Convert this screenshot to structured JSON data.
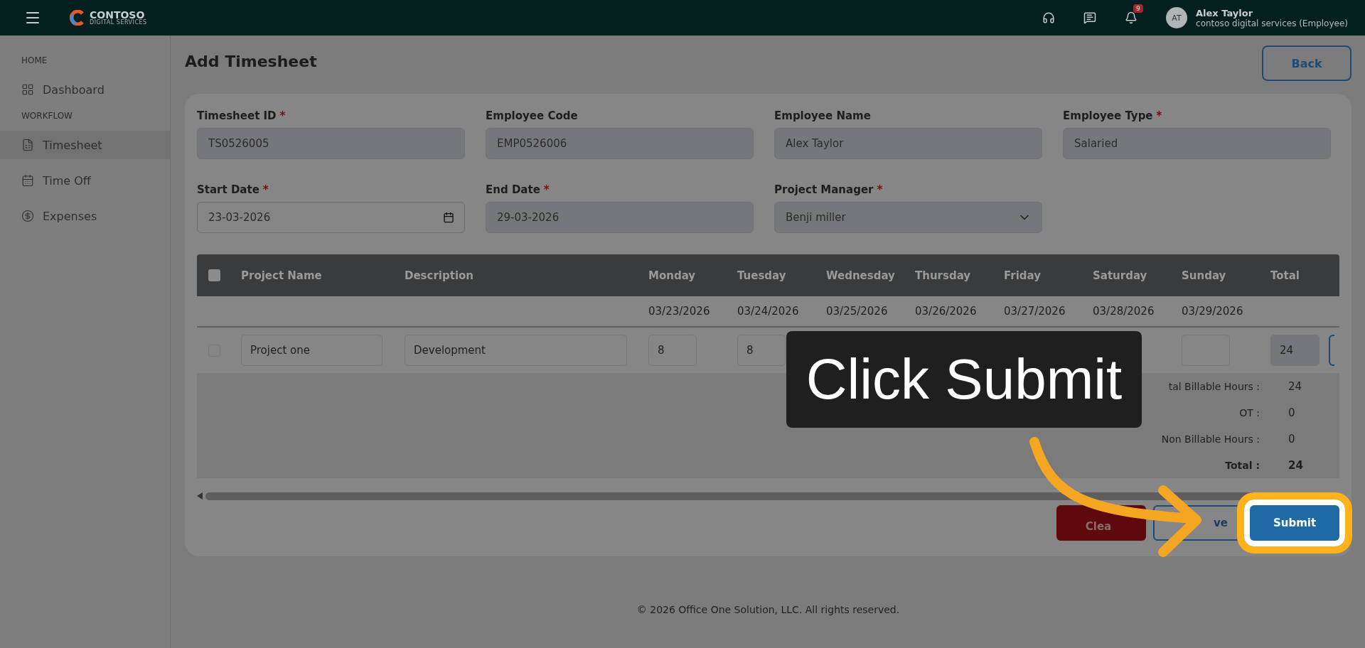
{
  "topbar": {
    "brand": "CONTOSO",
    "brand_sub": "DIGITAL SERVICES",
    "notification_count": "9",
    "user": {
      "initials": "AT",
      "name": "Alex Taylor",
      "org": "contoso digital services (Employee)"
    }
  },
  "sidebar": [
    {
      "heading": "HOME",
      "items": [
        {
          "label": "Dashboard",
          "selected": false
        }
      ]
    },
    {
      "heading": "WORKFLOW",
      "items": [
        {
          "label": "Timesheet",
          "selected": true
        },
        {
          "label": "Time Off",
          "selected": false
        },
        {
          "label": "Expenses",
          "selected": false
        }
      ]
    }
  ],
  "page": {
    "title": "Add Timesheet",
    "back_button": "Back"
  },
  "fields": [
    {
      "label": "Timesheet ID",
      "required_mark": "*",
      "value": "TS0526005",
      "kind": "text"
    },
    {
      "label": "Employee Code",
      "value": "EMP0526006",
      "kind": "text"
    },
    {
      "label": "Employee Name",
      "value": "Alex Taylor",
      "kind": "text"
    },
    {
      "label": "Employee Type",
      "required_mark": "*",
      "value": "Salaried",
      "kind": "text"
    },
    {
      "label": "Start Date",
      "required_mark": "*",
      "value": "23-03-2026",
      "kind": "date"
    },
    {
      "label": "End Date",
      "required_mark": "*",
      "value": "29-03-2026",
      "kind": "text"
    },
    {
      "label": "Project Manager",
      "required_mark": "*",
      "value": "Benji miller",
      "kind": "select"
    }
  ],
  "table": {
    "header_checked": false,
    "columns": [
      "Project Name",
      "Description"
    ],
    "days": [
      {
        "name": "Monday",
        "date": "03/23/2026"
      },
      {
        "name": "Tuesday",
        "date": "03/24/2026"
      },
      {
        "name": "Wednesday",
        "date": "03/25/2026"
      },
      {
        "name": "Thursday",
        "date": "03/26/2026"
      },
      {
        "name": "Friday",
        "date": "03/27/2026"
      },
      {
        "name": "Saturday",
        "date": "03/28/2026"
      },
      {
        "name": "Sunday",
        "date": "03/29/2026"
      }
    ],
    "total_column": "Total",
    "rows": [
      {
        "checked": false,
        "project": "Project one",
        "description": "Development",
        "hours": [
          "8",
          "8"
        ],
        "total": "24"
      }
    ]
  },
  "summary": [
    {
      "label": "tal Billable Hours :",
      "value": "24",
      "kind": "line"
    },
    {
      "label": "OT :",
      "value": "0",
      "kind": "line"
    },
    {
      "label": "Non Billable Hours :",
      "value": "0",
      "kind": "line"
    },
    {
      "label": "Total :",
      "value": "24",
      "kind": "total"
    }
  ],
  "actions": [
    {
      "label": "Clea",
      "kind": "danger",
      "highlighted": false
    },
    {
      "label": "ve",
      "kind": "outline",
      "highlighted": false
    },
    {
      "label": "Submit",
      "kind": "primary",
      "highlighted": true
    }
  ],
  "callout": {
    "text": "Click Submit"
  },
  "footer": "© 2026 Office One Solution, LLC. All rights reserved."
}
